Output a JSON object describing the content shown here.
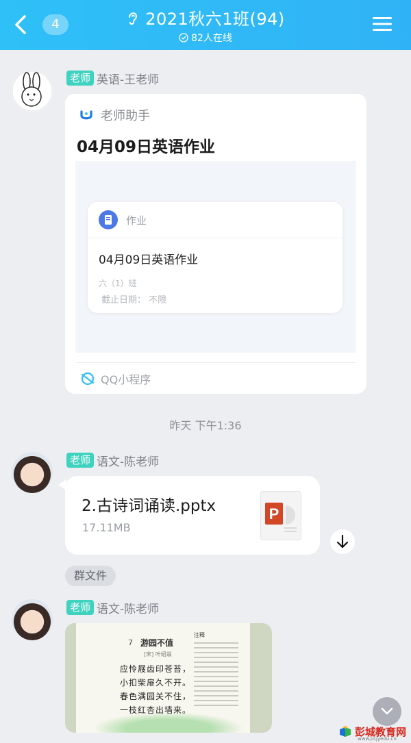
{
  "header": {
    "back_badge": "4",
    "title": "2021秋六1班(94)",
    "online": "82人在线"
  },
  "messages": [
    {
      "role": "老师",
      "sender": "英语-王老师",
      "mini_program": {
        "app_name": "老师助手",
        "title": "04月09日英语作业",
        "homework": {
          "label": "作业",
          "title": "04月09日英语作业",
          "class": "六（1）班",
          "deadline": "截止日期：  不限"
        },
        "source": "QQ小程序"
      }
    },
    {
      "role": "老师",
      "sender": "语文-陈老师",
      "file": {
        "name": "2.古诗词诵读.pptx",
        "size": "17.11MB"
      },
      "group_file_tag": "群文件"
    },
    {
      "role": "老师",
      "sender": "语文-陈老师",
      "image": {
        "page_num": "7",
        "title": "游园不值",
        "author": "[宋] 叶绍翁",
        "lines": [
          "应怜屐齿印苍苔，",
          "小扣柴扉久不开。",
          "春色满园关不住，",
          "一枝红杏出墙来。"
        ],
        "note_head": "注释"
      }
    }
  ],
  "timestamp": "昨天 下午1:36",
  "watermark": {
    "name": "彭城教育网",
    "url": "www.pcjyedu.cn"
  },
  "colors": {
    "header": "#30b8f6",
    "role_tag": "#3ed2bf",
    "ppt": "#d24726"
  }
}
